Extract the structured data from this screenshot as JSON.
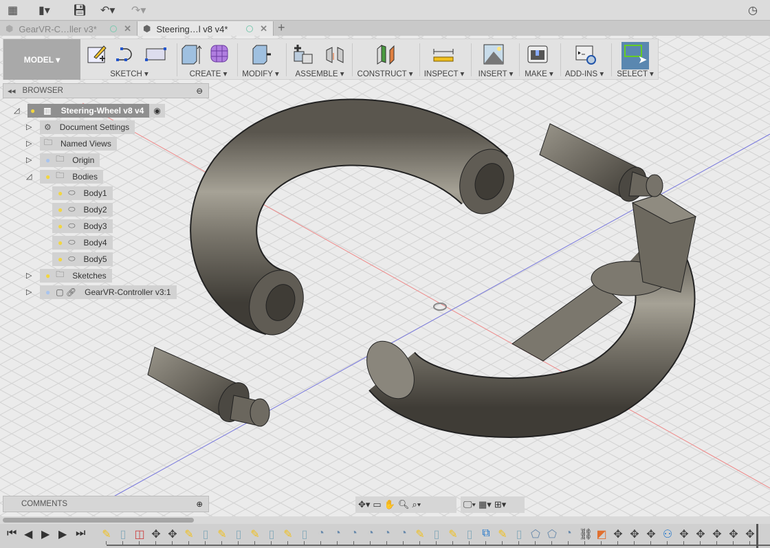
{
  "topbar": {
    "icons": [
      "grid-menu-icon",
      "file-icon",
      "save-icon",
      "undo-icon",
      "redo-icon",
      "clock-icon"
    ]
  },
  "tabs": [
    {
      "label": "GearVR-C…ller v3*",
      "active": false
    },
    {
      "label": "Steering…l v8 v4*",
      "active": true
    }
  ],
  "toolbar": {
    "workspace": "MODEL ▾",
    "groups": [
      {
        "label": "SKETCH ▾"
      },
      {
        "label": "CREATE ▾"
      },
      {
        "label": "MODIFY ▾"
      },
      {
        "label": "ASSEMBLE ▾"
      },
      {
        "label": "CONSTRUCT ▾"
      },
      {
        "label": "INSPECT ▾"
      },
      {
        "label": "INSERT ▾"
      },
      {
        "label": "MAKE ▾"
      },
      {
        "label": "ADD-INS ▾"
      },
      {
        "label": "SELECT ▾"
      }
    ]
  },
  "browser": {
    "title": "BROWSER",
    "root": "Steering-Wheel v8 v4",
    "items": [
      {
        "label": "Document Settings",
        "icon": "gear-icon"
      },
      {
        "label": "Named Views",
        "icon": "folder-icon"
      },
      {
        "label": "Origin",
        "icon": "folder-icon",
        "bulb": "blue"
      },
      {
        "label": "Bodies",
        "icon": "folder-icon",
        "bulb": "yellow",
        "expanded": true
      },
      {
        "label": "Body1",
        "icon": "body-icon",
        "bulb": "yellow"
      },
      {
        "label": "Body2",
        "icon": "body-icon",
        "bulb": "yellow"
      },
      {
        "label": "Body3",
        "icon": "body-icon",
        "bulb": "yellow"
      },
      {
        "label": "Body4",
        "icon": "body-icon",
        "bulb": "yellow"
      },
      {
        "label": "Body5",
        "icon": "body-icon",
        "bulb": "yellow"
      },
      {
        "label": "Sketches",
        "icon": "folder-icon",
        "bulb": "yellow"
      },
      {
        "label": "GearVR-Controller v3:1",
        "icon": "component-link-icon",
        "bulb": "blue"
      }
    ]
  },
  "comments": {
    "title": "COMMENTS"
  },
  "colors": {
    "select_active": "#5a87b0",
    "body": "#6f6b62",
    "axis_red": "#e06060",
    "axis_blue": "#6060e0"
  },
  "timeline": [
    "sketch",
    "extrude",
    "form",
    "move",
    "move",
    "sketch",
    "extrude",
    "sketch",
    "extrude",
    "sketch",
    "extrude",
    "sketch",
    "extrude",
    "fillet",
    "fillet",
    "fillet",
    "fillet",
    "fillet",
    "fillet",
    "sketch",
    "extrude",
    "sketch",
    "extrude",
    "shell",
    "sketch",
    "extrude",
    "chamfer",
    "chamfer",
    "fillet",
    "joint",
    "combine",
    "move",
    "move",
    "move",
    "align",
    "move",
    "move",
    "move",
    "move",
    "move"
  ]
}
